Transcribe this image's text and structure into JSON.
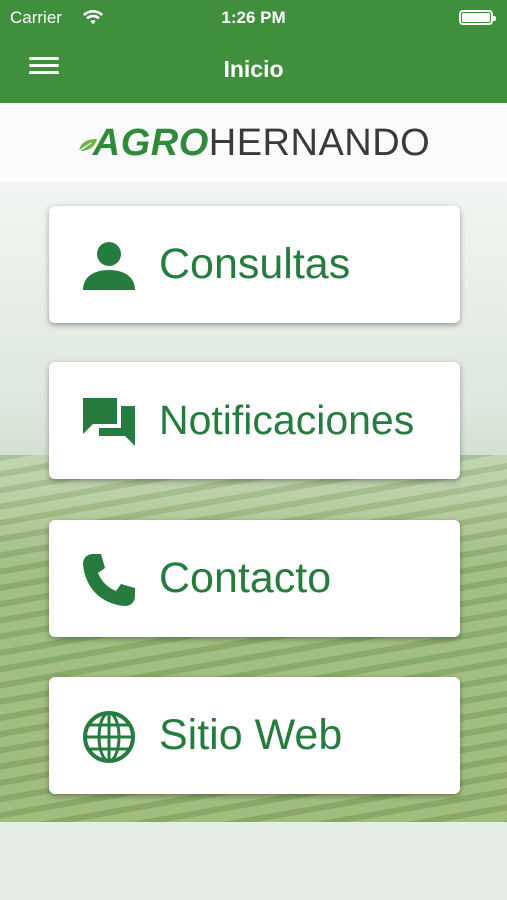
{
  "status_bar": {
    "carrier": "Carrier",
    "time": "1:26 PM"
  },
  "header": {
    "title": "Inicio"
  },
  "logo": {
    "agro": "AGRO",
    "hernando": "HERNANDO"
  },
  "menu": [
    {
      "label": "Consultas",
      "icon": "person-icon"
    },
    {
      "label": "Notificaciones",
      "icon": "chat-bubbles-icon"
    },
    {
      "label": "Contacto",
      "icon": "phone-icon"
    },
    {
      "label": "Sitio Web",
      "icon": "globe-icon"
    }
  ],
  "colors": {
    "header_green": "#3f8f3c",
    "accent_green": "#267c3e",
    "logo_dark": "#3a3a3a"
  }
}
